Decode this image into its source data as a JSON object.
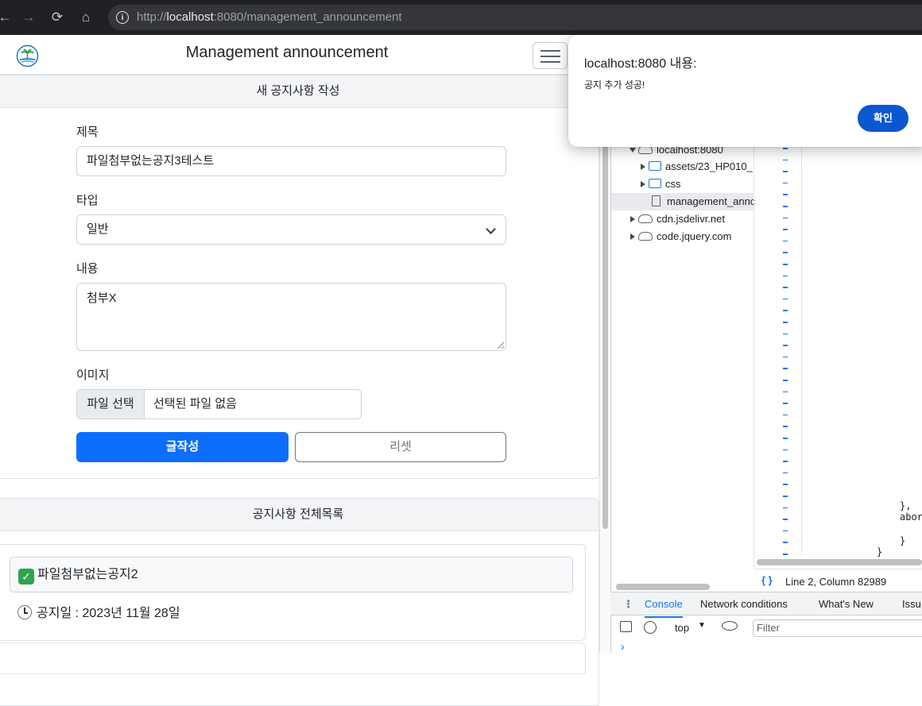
{
  "browser": {
    "url_prefix": "http://",
    "url_host": "localhost",
    "url_rest": ":8080/management_announcement"
  },
  "header": {
    "title": "Management announcement"
  },
  "form": {
    "section_title": "새 공지사항 작성",
    "title_label": "제목",
    "title_value": "파일첨부없는공지3테스트",
    "type_label": "타입",
    "type_value": "일반",
    "content_label": "내용",
    "content_value": "첨부X",
    "image_label": "이미지",
    "file_button": "파일 선택",
    "file_status": "선택된 파일 없음",
    "submit_label": "글작성",
    "reset_label": "리셋"
  },
  "list": {
    "section_title": "공지사항 전체목록",
    "items": [
      {
        "title": "파일첨부없는공지2",
        "date": "공지일 : 2023년 11월 28일"
      }
    ]
  },
  "devtools": {
    "tree": {
      "host": "localhost:8080",
      "assets": "assets/23_HP010_",
      "css": "css",
      "file": "management_annc",
      "cdn1": "cdn.jsdelivr.net",
      "cdn2": "code.jquery.com"
    },
    "code_lines": [
      "},",
      "abor",
      "}",
      "}"
    ],
    "status": "Line 2, Column 82989",
    "tabs": [
      "Console",
      "Network conditions",
      "What's New",
      "Issu"
    ],
    "context": "top",
    "filter_placeholder": "Filter",
    "prompt": "›"
  },
  "alert": {
    "title": "localhost:8080 내용:",
    "message": "공지 추가 성공!",
    "ok_label": "확인"
  },
  "colors": {
    "primary": "#0d6efd",
    "alert_button": "#0b57d0",
    "chrome_bar": "#202124"
  }
}
